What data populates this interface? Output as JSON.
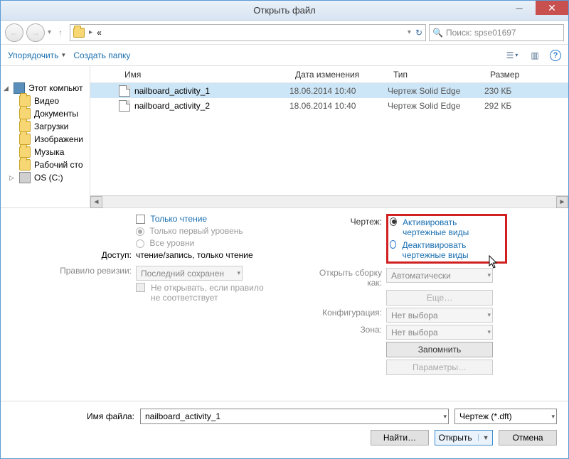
{
  "titlebar": {
    "title": "Открыть файл"
  },
  "nav": {
    "path_crumbs": [
      "«"
    ],
    "search_placeholder": "Поиск: spse01697"
  },
  "toolbar": {
    "organize": "Упорядочить",
    "new_folder": "Создать папку"
  },
  "tree": {
    "root": "Этот компьют",
    "items": [
      "Видео",
      "Документы",
      "Загрузки",
      "Изображени",
      "Музыка",
      "Рабочий сто",
      "OS (C:)"
    ]
  },
  "file_list": {
    "columns": {
      "name": "Имя",
      "date": "Дата изменения",
      "type": "Тип",
      "size": "Размер"
    },
    "rows": [
      {
        "name": "nailboard_activity_1",
        "date": "18.06.2014 10:40",
        "type": "Чертеж Solid Edge",
        "size": "230 КБ",
        "selected": true
      },
      {
        "name": "nailboard_activity_2",
        "date": "18.06.2014 10:40",
        "type": "Чертеж Solid Edge",
        "size": "292 КБ",
        "selected": false
      }
    ]
  },
  "options": {
    "readonly": "Только чтение",
    "first_level": "Только первый уровень",
    "all_levels": "Все уровни",
    "access_label": "Доступ:",
    "access_value": "чтение/запись, только чтение",
    "revision_label": "Правило ревизии:",
    "revision_value": "Последний сохранен",
    "dont_open": "Не открывать, если правило не соответствует",
    "drawing_label": "Чертеж:",
    "activate": "Активировать чертежные виды",
    "deactivate": "Деактивировать чертежные виды",
    "open_asm_label": "Открыть сборку как:",
    "open_asm_value": "Автоматически",
    "more": "Еще…",
    "config_label": "Конфигурация:",
    "zone_label": "Зона:",
    "no_choice": "Нет выбора",
    "remember": "Запомнить",
    "params": "Параметры…"
  },
  "footer": {
    "filename_label": "Имя файла:",
    "filename_value": "nailboard_activity_1",
    "filetype_value": "Чертеж (*.dft)",
    "find": "Найти…",
    "open": "Открыть",
    "cancel": "Отмена"
  }
}
